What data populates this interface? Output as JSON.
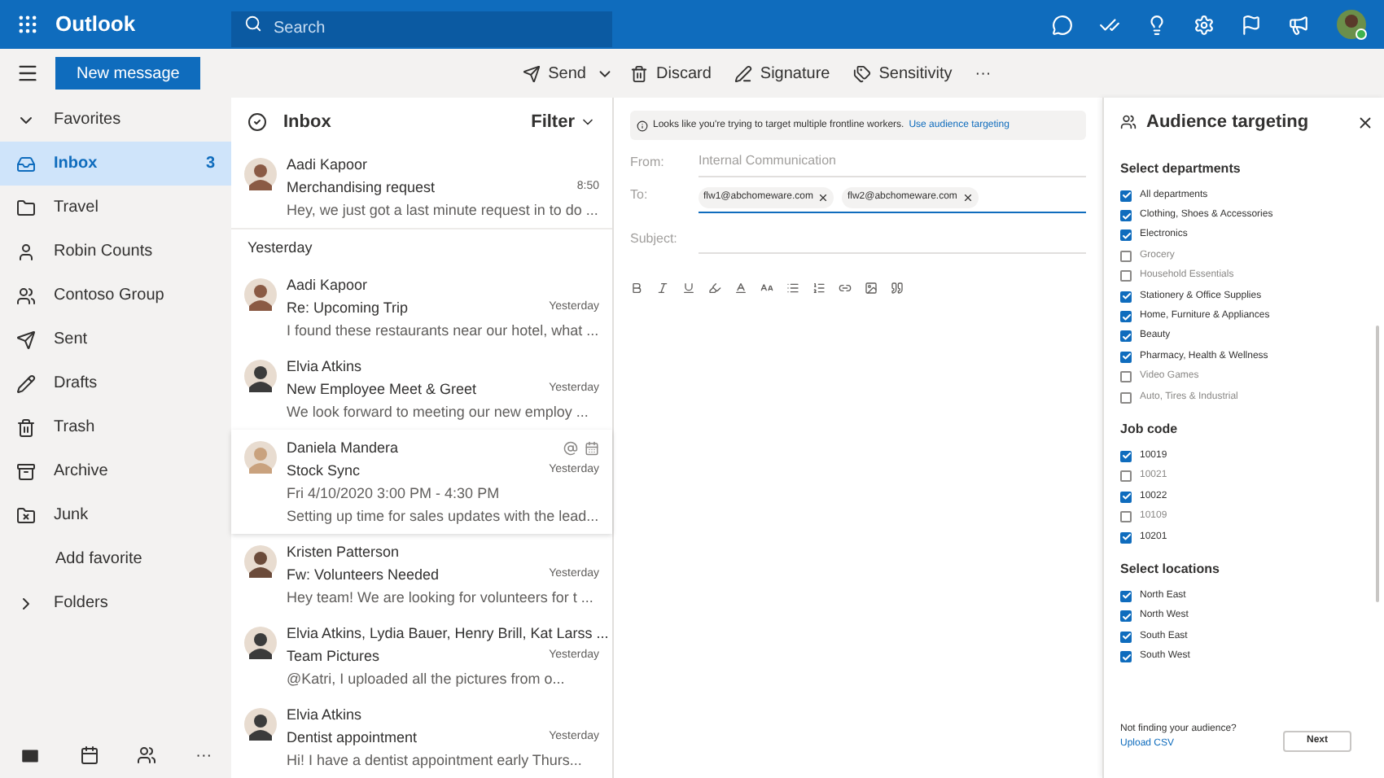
{
  "app": {
    "name": "Outlook",
    "search_placeholder": "Search"
  },
  "toolbar": {
    "new_message": "New message",
    "actions": [
      "Send",
      "Discard",
      "Signature",
      "Sensitivity"
    ],
    "more": "···"
  },
  "nav": {
    "favorites": {
      "label": "Favorites",
      "expanded": true
    },
    "items": [
      {
        "label": "Inbox",
        "count": "3",
        "selected": true
      },
      {
        "label": "Travel",
        "selected": false
      },
      {
        "label": "Robin Counts",
        "selected": false
      },
      {
        "label": "Contoso Group",
        "selected": false
      },
      {
        "label": "Sent",
        "selected": false
      },
      {
        "label": "Drafts",
        "selected": false
      },
      {
        "label": "Trash",
        "selected": false
      },
      {
        "label": "Archive",
        "selected": false
      },
      {
        "label": "Junk",
        "selected": false
      }
    ],
    "add_favorite": "Add favorite",
    "folders": {
      "label": "Folders",
      "expanded": false
    },
    "bottom_more": "···"
  },
  "list": {
    "title": "Inbox",
    "filter": "Filter",
    "groups": [
      {
        "messages": [
          {
            "sender": "Aadi Kapoor",
            "subject": "Merchandising request",
            "time": "8:50",
            "preview": "Hey, we just got a last minute request in to do ..."
          }
        ]
      },
      {
        "heading": "Yesterday",
        "messages": [
          {
            "sender": "Aadi Kapoor",
            "subject": "Re: Upcoming Trip",
            "time": "Yesterday",
            "preview": "I found these restaurants near our hotel, what ..."
          },
          {
            "sender": "Elvia Atkins",
            "subject": "New Employee Meet & Greet",
            "time": "Yesterday",
            "preview": "We look forward to meeting our new employ ..."
          },
          {
            "sender": "Daniela Mandera",
            "subject": "Stock Sync",
            "time": "Yesterday",
            "event": "Fri 4/10/2020 3:00 PM - 4:30 PM",
            "preview": "Setting up time for sales updates with the lead...",
            "mention": true,
            "meeting": true
          },
          {
            "sender": "Kristen Patterson",
            "subject": "Fw: Volunteers Needed",
            "time": "Yesterday",
            "preview": "Hey team! We are looking for volunteers for t ..."
          },
          {
            "sender": "Elvia Atkins, Lydia Bauer, Henry Brill, Kat Larss ...",
            "subject": "Team Pictures",
            "time": "Yesterday",
            "preview": "@Katri, I uploaded all the pictures from o..."
          },
          {
            "sender": "Elvia Atkins",
            "subject": "Dentist appointment",
            "time": "Yesterday",
            "preview": "Hi! I have a dentist appointment early Thurs..."
          }
        ]
      }
    ]
  },
  "compose": {
    "notice": "Looks like you're trying to target multiple frontline workers.",
    "notice_link": "Use audience targeting",
    "from_label": "From:",
    "from_value": "Internal Communication",
    "to_label": "To:",
    "recipients": [
      "flw1@abchomeware.com",
      "flw2@abchomeware.com"
    ],
    "subject_label": "Subject:"
  },
  "panel": {
    "title": "Audience targeting",
    "sections": [
      {
        "heading": "Select departments",
        "options": [
          {
            "label": "All departments",
            "checked": true
          },
          {
            "label": "Clothing, Shoes & Accessories",
            "checked": true
          },
          {
            "label": "Electronics",
            "checked": true
          },
          {
            "label": "Grocery",
            "checked": false
          },
          {
            "label": "Household Essentials",
            "checked": false
          },
          {
            "label": "Stationery & Office Supplies",
            "checked": true
          },
          {
            "label": "Home, Furniture & Appliances",
            "checked": true
          },
          {
            "label": "Beauty",
            "checked": true
          },
          {
            "label": "Pharmacy, Health & Wellness",
            "checked": true
          },
          {
            "label": "Video Games",
            "checked": false
          },
          {
            "label": "Auto, Tires & Industrial",
            "checked": false
          }
        ]
      },
      {
        "heading": "Job code",
        "options": [
          {
            "label": "10019",
            "checked": true
          },
          {
            "label": "10021",
            "checked": false
          },
          {
            "label": "10022",
            "checked": true
          },
          {
            "label": "10109",
            "checked": false
          },
          {
            "label": "10201",
            "checked": true
          }
        ]
      },
      {
        "heading": "Select locations",
        "options": [
          {
            "label": "North East",
            "checked": true
          },
          {
            "label": "North West",
            "checked": true
          },
          {
            "label": "South East",
            "checked": true
          },
          {
            "label": "South West",
            "checked": true
          }
        ]
      }
    ],
    "footer_text": "Not finding your audience?",
    "footer_link": "Upload CSV",
    "next": "Next"
  }
}
